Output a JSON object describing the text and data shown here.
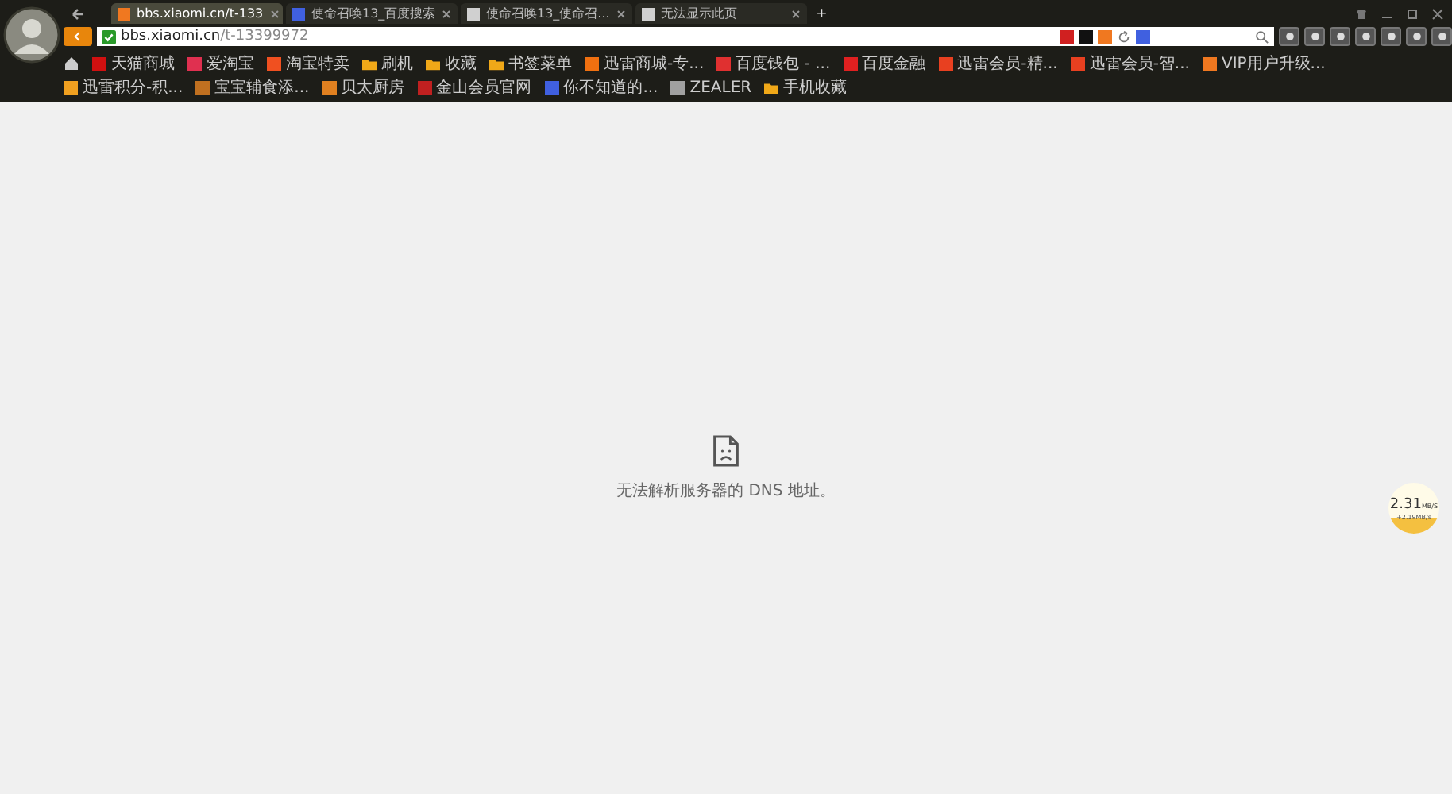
{
  "tabs": [
    {
      "label": "bbs.xiaomi.cn/t-133",
      "selected": true,
      "color": "#f07820"
    },
    {
      "label": "使命召唤13_百度搜索",
      "selected": false,
      "color": "#4060e0"
    },
    {
      "label": "使命召唤13_使命召...",
      "selected": false,
      "color": "#d0d0d0"
    },
    {
      "label": "无法显示此页",
      "selected": false,
      "color": "#d0d0d0"
    }
  ],
  "new_tab": "+",
  "address": {
    "host": "bbs.xiaomi.cn",
    "path": "/t-13399972",
    "secure": true
  },
  "bookmarks": [
    {
      "label": "天猫商城",
      "kind": "site",
      "color": "#d01010"
    },
    {
      "label": "爱淘宝",
      "kind": "site",
      "color": "#e03050"
    },
    {
      "label": "淘宝特卖",
      "kind": "site",
      "color": "#f05020"
    },
    {
      "label": "刷机",
      "kind": "folder"
    },
    {
      "label": "收藏",
      "kind": "folder"
    },
    {
      "label": "书签菜单",
      "kind": "folder"
    },
    {
      "label": "迅雷商城-专...",
      "kind": "site",
      "color": "#f07010"
    },
    {
      "label": "百度钱包 - ...",
      "kind": "site",
      "color": "#e03030"
    },
    {
      "label": "百度金融",
      "kind": "site",
      "color": "#e02020"
    },
    {
      "label": "迅雷会员-精...",
      "kind": "site",
      "color": "#e84020"
    },
    {
      "label": "迅雷会员-智...",
      "kind": "site",
      "color": "#e84020"
    },
    {
      "label": "VIP用户升级...",
      "kind": "site",
      "color": "#f07820"
    },
    {
      "label": "迅雷积分-积...",
      "kind": "site",
      "color": "#f0a020"
    },
    {
      "label": "宝宝辅食添...",
      "kind": "site",
      "color": "#c07020"
    },
    {
      "label": "贝太厨房",
      "kind": "site",
      "color": "#e08020"
    },
    {
      "label": "金山会员官网",
      "kind": "site",
      "color": "#c02020"
    },
    {
      "label": "你不知道的...",
      "kind": "site",
      "color": "#4060e0"
    },
    {
      "label": "ZEALER",
      "kind": "site",
      "color": "#a0a0a0"
    },
    {
      "label": "手机收藏",
      "kind": "folder"
    }
  ],
  "error": {
    "message": "无法解析服务器的 DNS 地址。"
  },
  "speed_widget": {
    "value": "2.31",
    "unit": "MB/S",
    "upload": "+2.19MB/s"
  }
}
